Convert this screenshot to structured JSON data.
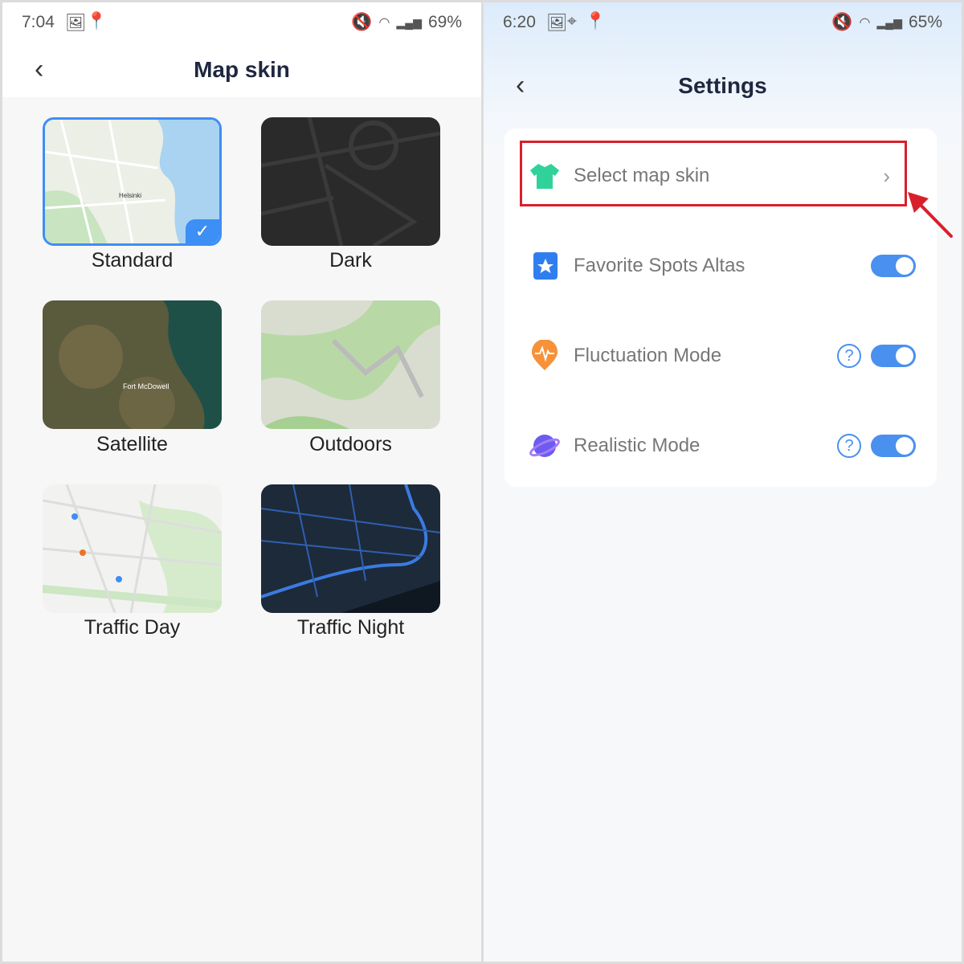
{
  "left": {
    "status": {
      "time": "7:04",
      "battery": "69%"
    },
    "title": "Map skin",
    "skins": [
      {
        "label": "Standard",
        "selected": true
      },
      {
        "label": "Dark",
        "selected": false
      },
      {
        "label": "Satellite",
        "selected": false
      },
      {
        "label": "Outdoors",
        "selected": false
      },
      {
        "label": "Traffic Day",
        "selected": false
      },
      {
        "label": "Traffic Night",
        "selected": false
      }
    ],
    "map_text": {
      "standard": "Helsinki",
      "satellite": "Fort McDowell"
    }
  },
  "right": {
    "status": {
      "time": "6:20",
      "battery": "65%"
    },
    "title": "Settings",
    "items": [
      {
        "label": "Select map skin",
        "icon": "t-shirt-icon",
        "type": "link"
      },
      {
        "label": "Favorite Spots Altas",
        "icon": "atlas-star-icon",
        "type": "toggle",
        "on": true
      },
      {
        "label": "Fluctuation Mode",
        "icon": "pulse-pin-icon",
        "type": "toggle",
        "on": true,
        "help": true
      },
      {
        "label": "Realistic Mode",
        "icon": "planet-icon",
        "type": "toggle",
        "on": true,
        "help": true
      }
    ]
  },
  "colors": {
    "accent": "#3d8ef5",
    "highlight": "#d8202c"
  }
}
